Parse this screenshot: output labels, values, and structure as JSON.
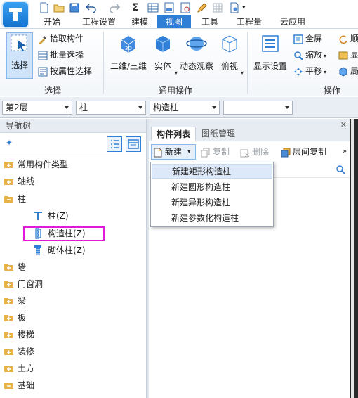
{
  "menu": {
    "tabs": [
      "开始",
      "工程设置",
      "建模",
      "视图",
      "工具",
      "工程量",
      "云应用"
    ],
    "active_tab": "视图"
  },
  "ribbon": {
    "select_group": {
      "label": "选择",
      "select_btn": "选择",
      "pick_component": "拾取构件",
      "batch_select": "批量选择",
      "select_by_attr": "按属性选择"
    },
    "common_ops": {
      "label": "通用操作",
      "view_2d3d": "二维/三维",
      "solid": "实体",
      "dynamic_view": "动态观察",
      "top_view": "俯视"
    },
    "operations": {
      "label": "操作",
      "display_settings": "显示设置",
      "fullscreen": "全屏",
      "zoom": "缩放",
      "pan": "平移",
      "cut_1": "顺",
      "cut_2": "显",
      "cut_3": "局"
    }
  },
  "filters": {
    "floor": "第2层",
    "category": "柱",
    "type": "构造柱",
    "extra": ""
  },
  "nav": {
    "title": "导航树",
    "items": [
      {
        "label": "常用构件类型"
      },
      {
        "label": "轴线"
      },
      {
        "label": "柱"
      },
      {
        "label": "柱(Z)"
      },
      {
        "label": "构造柱(Z)"
      },
      {
        "label": "砌体柱(Z)"
      },
      {
        "label": "墙"
      },
      {
        "label": "门窗洞"
      },
      {
        "label": "梁"
      },
      {
        "label": "板"
      },
      {
        "label": "楼梯"
      },
      {
        "label": "装修"
      },
      {
        "label": "土方"
      },
      {
        "label": "基础"
      }
    ]
  },
  "component_panel": {
    "tabs": [
      "构件列表",
      "图纸管理"
    ],
    "active_tab": "构件列表",
    "toolbar": {
      "new": "新建",
      "copy": "复制",
      "delete": "删除",
      "floor_copy": "层间复制"
    },
    "new_menu": [
      "新建矩形构造柱",
      "新建圆形构造柱",
      "新建异形构造柱",
      "新建参数化构造柱"
    ],
    "hovered_item": "新建矩形构造柱"
  },
  "colors": {
    "accent": "#2f7fd6",
    "highlight_box": "#e01ad8",
    "folder": "#e7b247"
  }
}
